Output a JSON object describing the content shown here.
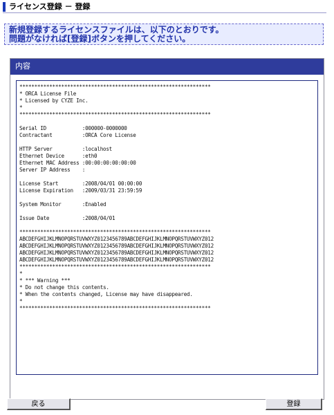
{
  "title": "ライセンス登録 － 登録",
  "notice": {
    "line1": "新規登録するライセンスファイルは、以下のとおりです。",
    "line2": "問題がなければ[登録]ボタンを押してください。"
  },
  "panel": {
    "header": "内容"
  },
  "license_text": "****************************************************************\n* ORCA License File\n* Licensed by CYZE Inc.\n*\n****************************************************************\n\nSerial ID            :000000-0000000\nContractant          :ORCA Core License\n\nHTTP Server          :localhost\nEthernet Device      :eth0\nEthernet MAC Address :00:00:00:00:00:00\nServer IP Address    :\n\nLicense Start        :2008/04/01 00:00:00\nLicense Expiration   :2009/03/31 23:59:59\n\nSystem Monitor       :Enabled\n\nIssue Date           :2008/04/01\n\n****************************************************************\nABCDEFGHIJKLMNOPQRSTUVWXYZ0123456789ABCDEFGHIJKLMNOPQRSTUVWXYZ012\nABCDEFGHIJKLMNOPQRSTUVWXYZ0123456789ABCDEFGHIJKLMNOPQRSTUVWXYZ012\nABCDEFGHIJKLMNOPQRSTUVWXYZ0123456789ABCDEFGHIJKLMNOPQRSTUVWXYZ012\nABCDEFGHIJKLMNOPQRSTUVWXYZ0123456789ABCDEFGHIJKLMNOPQRSTUVWXYZ012\n****************************************************************\n*\n* *** Warning ***\n* Do not change this contents.\n* When the contents changed, License may have disappeared.\n*\n****************************************************************",
  "buttons": {
    "back": "戻る",
    "register": "登録"
  },
  "colors": {
    "accent": "#2f3c9c",
    "notice_text": "#2233aa",
    "notice_bg": "#e8ecff"
  }
}
